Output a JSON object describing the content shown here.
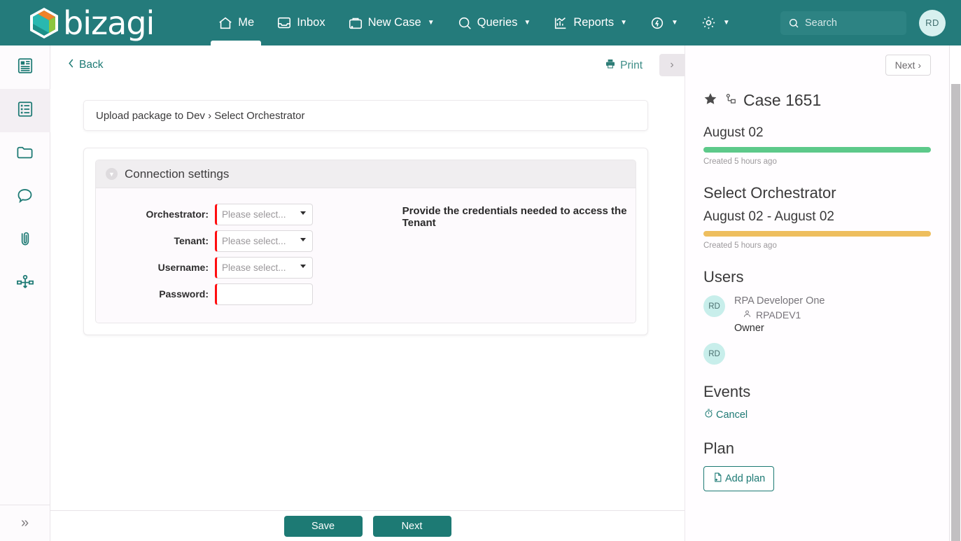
{
  "brand": {
    "name": "bizagi",
    "accent": "#247b7b",
    "logo_colors": [
      "#f08229",
      "#8cc63f",
      "#29b8b0",
      "#1c8f88"
    ]
  },
  "topbar": {
    "nav": [
      {
        "label": "Me",
        "icon": "home-icon",
        "caret": false,
        "active": true
      },
      {
        "label": "Inbox",
        "icon": "inbox-icon",
        "caret": false,
        "active": false
      },
      {
        "label": "New Case",
        "icon": "briefcase-plus-icon",
        "caret": true,
        "active": false
      },
      {
        "label": "Queries",
        "icon": "search-icon",
        "caret": true,
        "active": false
      },
      {
        "label": "Reports",
        "icon": "chart-icon",
        "caret": true,
        "active": false
      },
      {
        "label": "",
        "icon": "refresh-bolt-icon",
        "caret": true,
        "active": false
      },
      {
        "label": "",
        "icon": "gear-icon",
        "caret": true,
        "active": false
      }
    ],
    "search": {
      "placeholder": "Search",
      "value": ""
    },
    "avatar_initials": "RD"
  },
  "rail": {
    "items": [
      {
        "name": "summary-icon",
        "active": false
      },
      {
        "name": "forms-list-icon",
        "active": true
      },
      {
        "name": "folder-icon",
        "active": false
      },
      {
        "name": "comments-icon",
        "active": false
      },
      {
        "name": "attachments-icon",
        "active": false
      },
      {
        "name": "process-diagram-icon",
        "active": false
      }
    ],
    "expand_label": "»"
  },
  "center": {
    "back_label": "Back",
    "print_label": "Print",
    "collapse_label": "›",
    "breadcrumb": "Upload package to Dev › Select Orchestrator",
    "panel_title": "Connection settings",
    "hint": "Provide the credentials needed to access the Tenant",
    "fields": [
      {
        "label": "Orchestrator:",
        "placeholder": "Please select...",
        "value": "",
        "type": "select",
        "required": true
      },
      {
        "label": "Tenant:",
        "placeholder": "Please select...",
        "value": "",
        "type": "select",
        "required": true
      },
      {
        "label": "Username:",
        "placeholder": "Please select...",
        "value": "",
        "type": "select",
        "required": true
      },
      {
        "label": "Password:",
        "placeholder": "",
        "value": "",
        "type": "password",
        "required": true
      }
    ],
    "footer": {
      "save_label": "Save",
      "next_label": "Next"
    }
  },
  "rightpanel": {
    "next_top_label": "Next ›",
    "case_title": "Case 1651",
    "stages": [
      {
        "date": "August 02",
        "note": "Created 5 hours ago",
        "color": "#5dc98a"
      },
      {
        "title": "Select Orchestrator",
        "date": "August 02 - August 02",
        "note": "Created 5 hours ago",
        "color": "#eebe5e"
      }
    ],
    "users_heading": "Users",
    "users": [
      {
        "initials": "RD",
        "name": "RPA Developer One",
        "login": "RPADEV1",
        "role": "Owner"
      },
      {
        "initials": "RD",
        "name": "",
        "login": "",
        "role": ""
      }
    ],
    "events_heading": "Events",
    "events": [
      {
        "label": "Cancel",
        "icon": "stopwatch-icon"
      }
    ],
    "plan_heading": "Plan",
    "add_plan_label": "Add plan"
  }
}
